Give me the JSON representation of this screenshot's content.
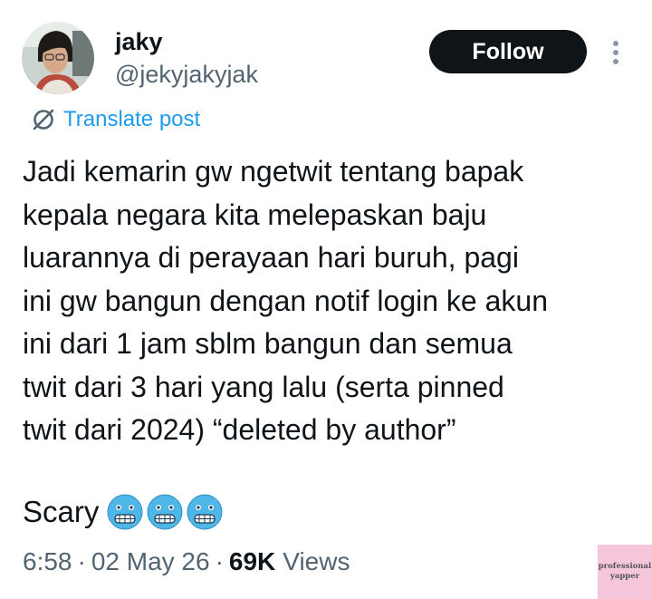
{
  "author": {
    "display_name": "jaky",
    "handle": "@jekyjakyjak"
  },
  "actions": {
    "follow_label": "Follow",
    "more_icon": "more-vertical-icon"
  },
  "translate": {
    "label": "Translate post",
    "icon": "translate-icon"
  },
  "tweet": {
    "lines": [
      "Jadi kemarin gw ngetwit tentang bapak",
      "kepala negara kita melepaskan baju",
      "luarannya di perayaan hari buruh, pagi",
      "ini gw bangun dengan notif login ke akun",
      "ini dari 1 jam sblm bangun dan semua",
      "twit dari 3 hari yang lalu (serta pinned",
      "twit dari 2024) “deleted by author”"
    ],
    "closing_word": "Scary",
    "emojis": [
      "cold-face-emoji",
      "cold-face-emoji",
      "cold-face-emoji"
    ]
  },
  "meta": {
    "time": "6:58",
    "separator": "·",
    "date": "02 May 26",
    "views_count": "69K",
    "views_label": "Views"
  },
  "watermark": {
    "line1": "professional",
    "line2": "yapper"
  },
  "colors": {
    "text_primary": "#0f1419",
    "text_secondary": "#536471",
    "link_blue": "#1d9bf0",
    "follow_bg": "#0f1419",
    "watermark_bg": "#f6c6dd"
  }
}
